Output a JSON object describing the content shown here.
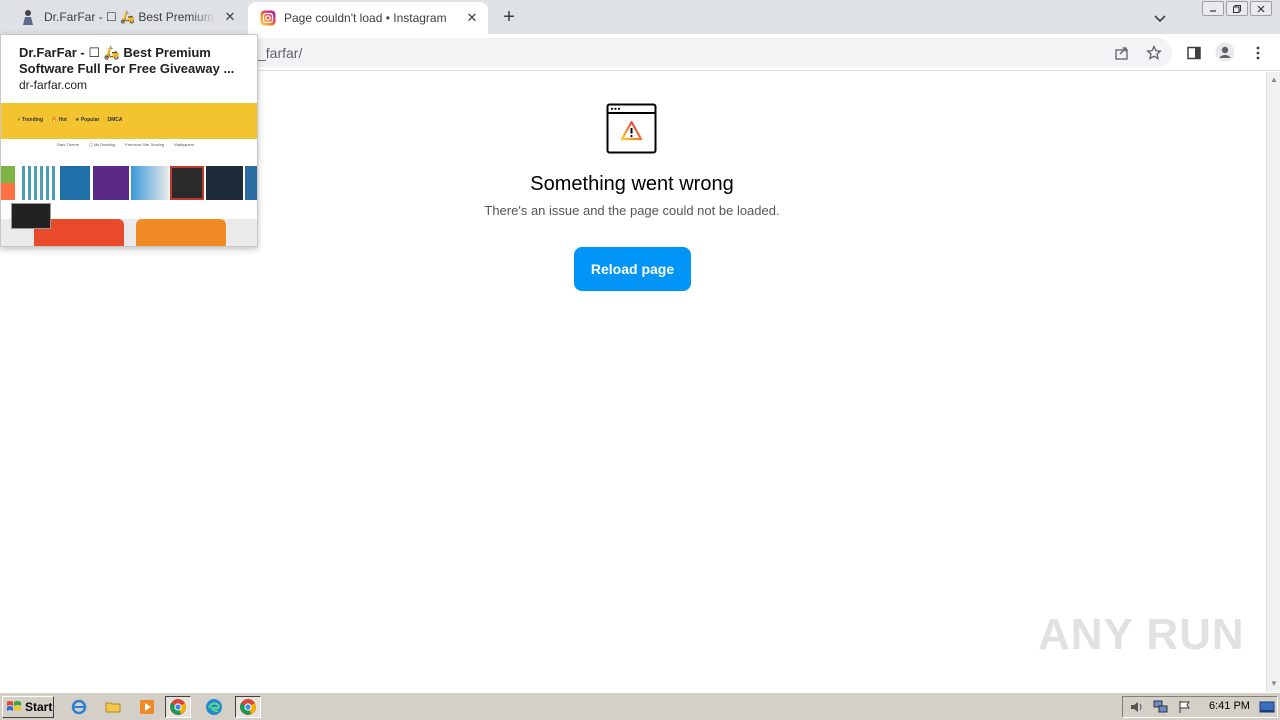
{
  "browser": {
    "tabs": [
      {
        "title": "Dr.FarFar - ☐ 🛵 Best Premium Software Full For Free Giveaway ...",
        "favicon": "drfarfar-icon",
        "active": false
      },
      {
        "title": "Page couldn't load • Instagram",
        "favicon": "instagram-icon",
        "active": true
      }
    ],
    "new_tab_label": "+",
    "close_glyph": "✕",
    "url": "_farfar/"
  },
  "hover_card": {
    "title": "Dr.FarFar - ☐ 🛵 Best Premium Software Full For Free Giveaway ...",
    "domain": "dr-farfar.com",
    "preview": {
      "nav": [
        "⚡ Trending",
        "🔥 Hot",
        "★ Popular",
        "DMCA"
      ],
      "links": [
        "Dark Theme",
        "▢ Mk Reading",
        "Premium Site Tending",
        "Wallpapers"
      ]
    }
  },
  "error_page": {
    "title": "Something went wrong",
    "subtitle": "There's an issue and the page could not be loaded.",
    "reload_label": "Reload page"
  },
  "watermark": "ANY RUN",
  "taskbar": {
    "start_label": "Start",
    "clock": "6:41 PM"
  },
  "colors": {
    "reload_button": "#0095f6",
    "tabstrip": "#dee1e6",
    "taskbar": "#d4d0c8"
  }
}
